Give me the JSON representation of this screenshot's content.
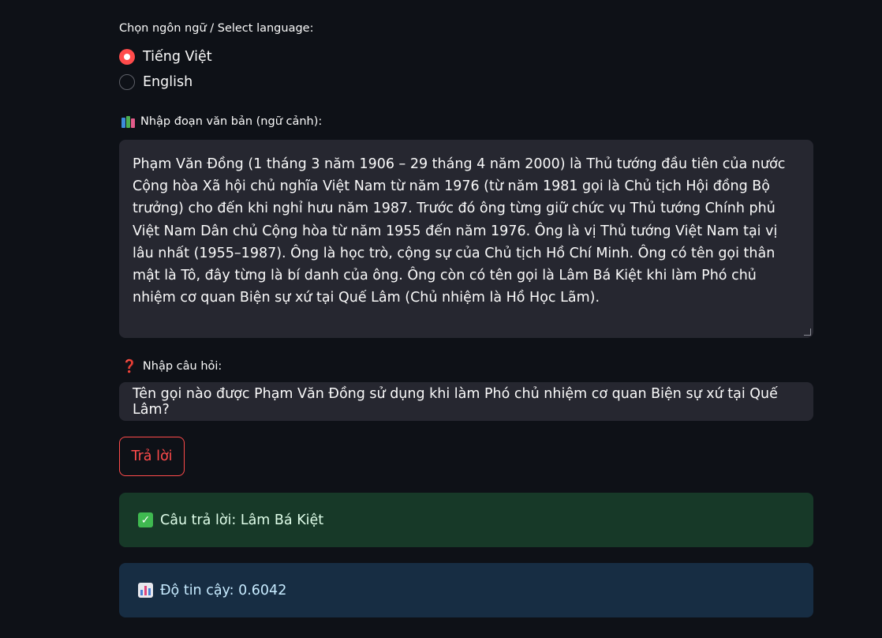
{
  "language": {
    "label": "Chọn ngôn ngữ / Select language:",
    "options": [
      "Tiếng Việt",
      "English"
    ],
    "selected": "Tiếng Việt"
  },
  "context": {
    "label": "Nhập đoạn văn bản (ngữ cảnh):",
    "value": "Phạm Văn Đồng (1 tháng 3 năm 1906 – 29 tháng 4 năm 2000) là Thủ tướng đầu tiên của nước Cộng hòa Xã hội chủ nghĩa Việt Nam từ năm 1976 (từ năm 1981 gọi là Chủ tịch Hội đồng Bộ trưởng) cho đến khi nghỉ hưu năm 1987. Trước đó ông từng giữ chức vụ Thủ tướng Chính phủ Việt Nam Dân chủ Cộng hòa từ năm 1955 đến năm 1976. Ông là vị Thủ tướng Việt Nam tại vị lâu nhất (1955–1987). Ông là học trò, cộng sự của Chủ tịch Hồ Chí Minh. Ông có tên gọi thân mật là Tô, đây từng là bí danh của ông. Ông còn có tên gọi là Lâm Bá Kiệt khi làm Phó chủ nhiệm cơ quan Biện sự xứ tại Quế Lâm (Chủ nhiệm là Hồ Học Lãm)."
  },
  "question": {
    "label": "Nhập câu hỏi:",
    "value": "Tên gọi nào được Phạm Văn Đồng sử dụng khi làm Phó chủ nhiệm cơ quan Biện sự xứ tại Quế Lâm?"
  },
  "submit_label": "Trả lời",
  "result": {
    "answer_text": "Câu trả lời: Lâm Bá Kiệt",
    "confidence_text": "Độ tin cậy: 0.6042"
  },
  "colors": {
    "background": "#0e1117",
    "accent": "#ff4b4b",
    "input_bg": "#262730",
    "success_bg": "#173928",
    "info_bg": "#172d43"
  },
  "icons": {
    "context_label_icon": "books-icon",
    "question_label_icon": "question-mark-icon",
    "answer_icon": "check-mark-icon",
    "confidence_icon": "bar-chart-icon"
  }
}
